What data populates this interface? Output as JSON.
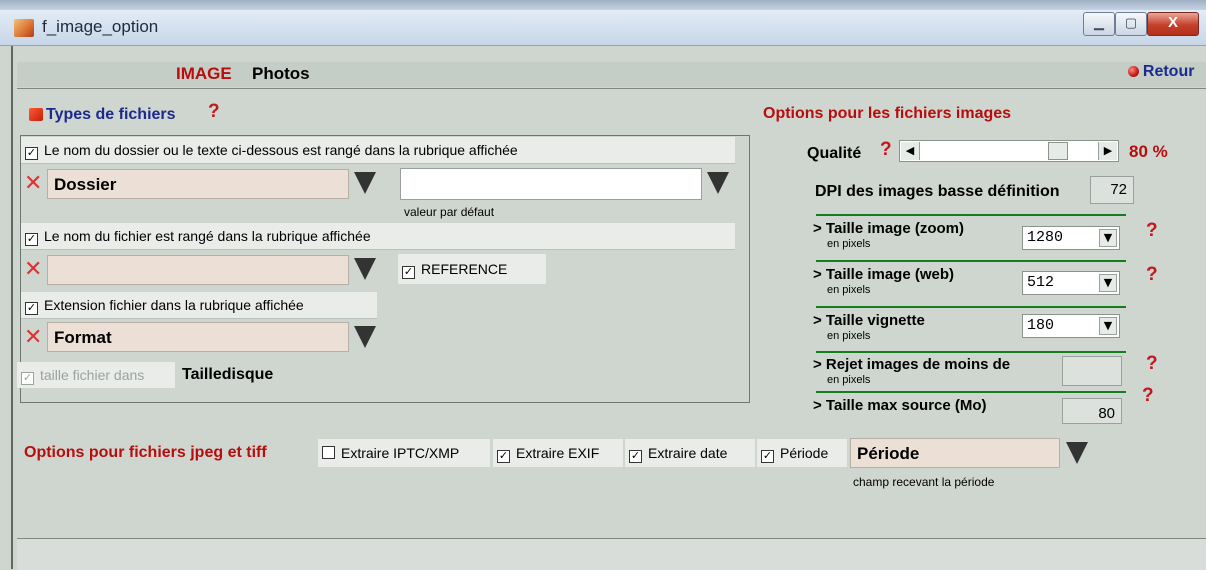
{
  "window": {
    "title": "f_image_option",
    "buttons": {
      "minimize": "▁",
      "maximize": "▢",
      "close": "X"
    }
  },
  "header": {
    "label_red": "IMAGE",
    "label_black": "Photos",
    "retour": "Retour"
  },
  "types_section": {
    "title": "Types de fichiers",
    "help": "?",
    "dossier_check": {
      "checked": true,
      "label": "Le nom du dossier ou le texte ci-dessous est rangé dans la rubrique affichée"
    },
    "dossier_field": "Dossier",
    "default_value_input": "",
    "default_value_caption": "valeur par défaut",
    "fichier_check": {
      "checked": true,
      "label": "Le nom du fichier est rangé dans la rubrique affichée"
    },
    "fichier_field": "",
    "reference_check": {
      "checked": true,
      "label": "REFERENCE"
    },
    "extension_check": {
      "checked": true,
      "label": "Extension fichier dans la rubrique affichée"
    },
    "format_field": "Format",
    "taille_check": {
      "checked": true,
      "label": "taille fichier dans"
    },
    "taille_value": "Tailledisque"
  },
  "options_images": {
    "title": "Options pour les fichiers images",
    "qualite_label": "Qualité",
    "help": "?",
    "qualite_value": 80,
    "qualite_text": "80 %",
    "dpi_label": "DPI des images basse définition",
    "dpi_value": "72",
    "zoom_label": "> Taille image (zoom)",
    "zoom_sub": "en pixels",
    "zoom_value": "1280",
    "web_label": "> Taille image (web)",
    "web_sub": "en pixels",
    "web_value": "512",
    "vignette_label": "> Taille vignette",
    "vignette_sub": "en pixels",
    "vignette_value": "180",
    "rejet_label": "> Rejet images de moins de",
    "rejet_sub": "en pixels",
    "rejet_value": "",
    "max_label": "> Taille max source (Mo)",
    "max_value": "80"
  },
  "jpeg_options": {
    "title": "Options pour fichiers jpeg et tiff",
    "iptc": {
      "checked": false,
      "label": "Extraire IPTC/XMP"
    },
    "exif": {
      "checked": true,
      "label": "Extraire EXIF"
    },
    "date": {
      "checked": true,
      "label": "Extraire date"
    },
    "periode": {
      "checked": true,
      "label": "Période"
    },
    "periode_field": "Période",
    "periode_caption": "champ recevant la période"
  },
  "colors": {
    "accent_red": "#b80d0d",
    "navy": "#1c2a8c",
    "green_rule": "#157e1c",
    "field_bg": "#ece0d6"
  }
}
